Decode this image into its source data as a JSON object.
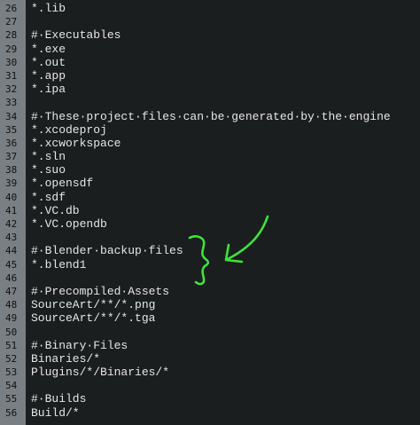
{
  "editor": {
    "lines": [
      {
        "num": "26",
        "text": "*.lib"
      },
      {
        "num": "27",
        "text": ""
      },
      {
        "num": "28",
        "text": "#·Executables"
      },
      {
        "num": "29",
        "text": "*.exe"
      },
      {
        "num": "30",
        "text": "*.out"
      },
      {
        "num": "31",
        "text": "*.app"
      },
      {
        "num": "32",
        "text": "*.ipa"
      },
      {
        "num": "33",
        "text": ""
      },
      {
        "num": "34",
        "text": "#·These·project·files·can·be·generated·by·the·engine"
      },
      {
        "num": "35",
        "text": "*.xcodeproj"
      },
      {
        "num": "36",
        "text": "*.xcworkspace"
      },
      {
        "num": "37",
        "text": "*.sln"
      },
      {
        "num": "38",
        "text": "*.suo"
      },
      {
        "num": "39",
        "text": "*.opensdf"
      },
      {
        "num": "40",
        "text": "*.sdf"
      },
      {
        "num": "41",
        "text": "*.VC.db"
      },
      {
        "num": "42",
        "text": "*.VC.opendb"
      },
      {
        "num": "43",
        "text": ""
      },
      {
        "num": "44",
        "text": "#·Blender·backup·files"
      },
      {
        "num": "45",
        "text": "*.blend1"
      },
      {
        "num": "46",
        "text": ""
      },
      {
        "num": "47",
        "text": "#·Precompiled·Assets"
      },
      {
        "num": "48",
        "text": "SourceArt/**/*.png"
      },
      {
        "num": "49",
        "text": "SourceArt/**/*.tga"
      },
      {
        "num": "50",
        "text": ""
      },
      {
        "num": "51",
        "text": "#·Binary·Files"
      },
      {
        "num": "52",
        "text": "Binaries/*"
      },
      {
        "num": "53",
        "text": "Plugins/*/Binaries/*"
      },
      {
        "num": "54",
        "text": ""
      },
      {
        "num": "55",
        "text": "#·Builds"
      },
      {
        "num": "56",
        "text": "Build/*"
      }
    ]
  },
  "colors": {
    "background": "#1b1e1f",
    "gutter": "#7a7f83",
    "line_number": "#111111",
    "code_text": "#e6e6e6",
    "annotation": "#3ee23a"
  },
  "annotation": {
    "icons": [
      "curly-brace-annotation",
      "arrow-annotation"
    ]
  }
}
